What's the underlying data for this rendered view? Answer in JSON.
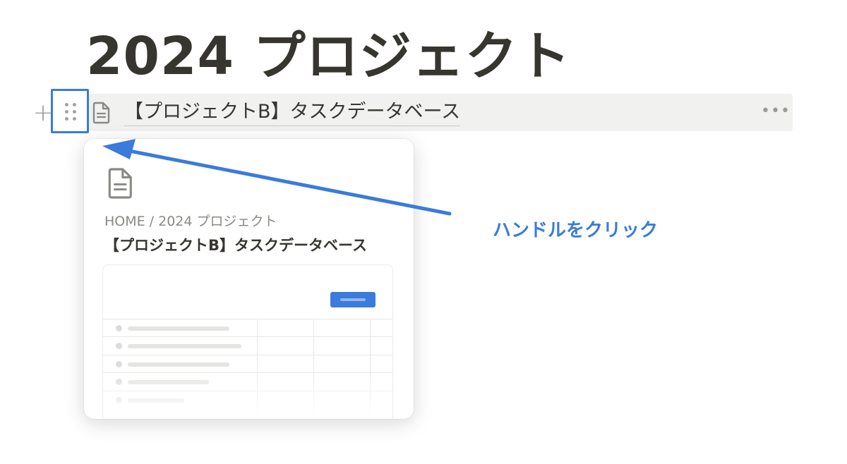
{
  "page": {
    "title": "2024 プロジェクト"
  },
  "block": {
    "text": "【プロジェクトB】タスクデータベース",
    "add_icon": "plus-icon",
    "handle_icon": "drag-handle-icon",
    "page_icon": "page-document-icon",
    "more_icon": "more-horizontal-icon",
    "more_label": "•••"
  },
  "preview": {
    "breadcrumb": "HOME / 2024 プロジェクト",
    "title": "【プロジェクトB】タスクデータベース"
  },
  "annotation": {
    "label": "ハンドルをクリック",
    "color": "#3a7bdb"
  },
  "colors": {
    "accent": "#3a7bdb",
    "text": "#37352f",
    "muted": "#9b9a97",
    "block_bg": "#f1f1ef"
  }
}
